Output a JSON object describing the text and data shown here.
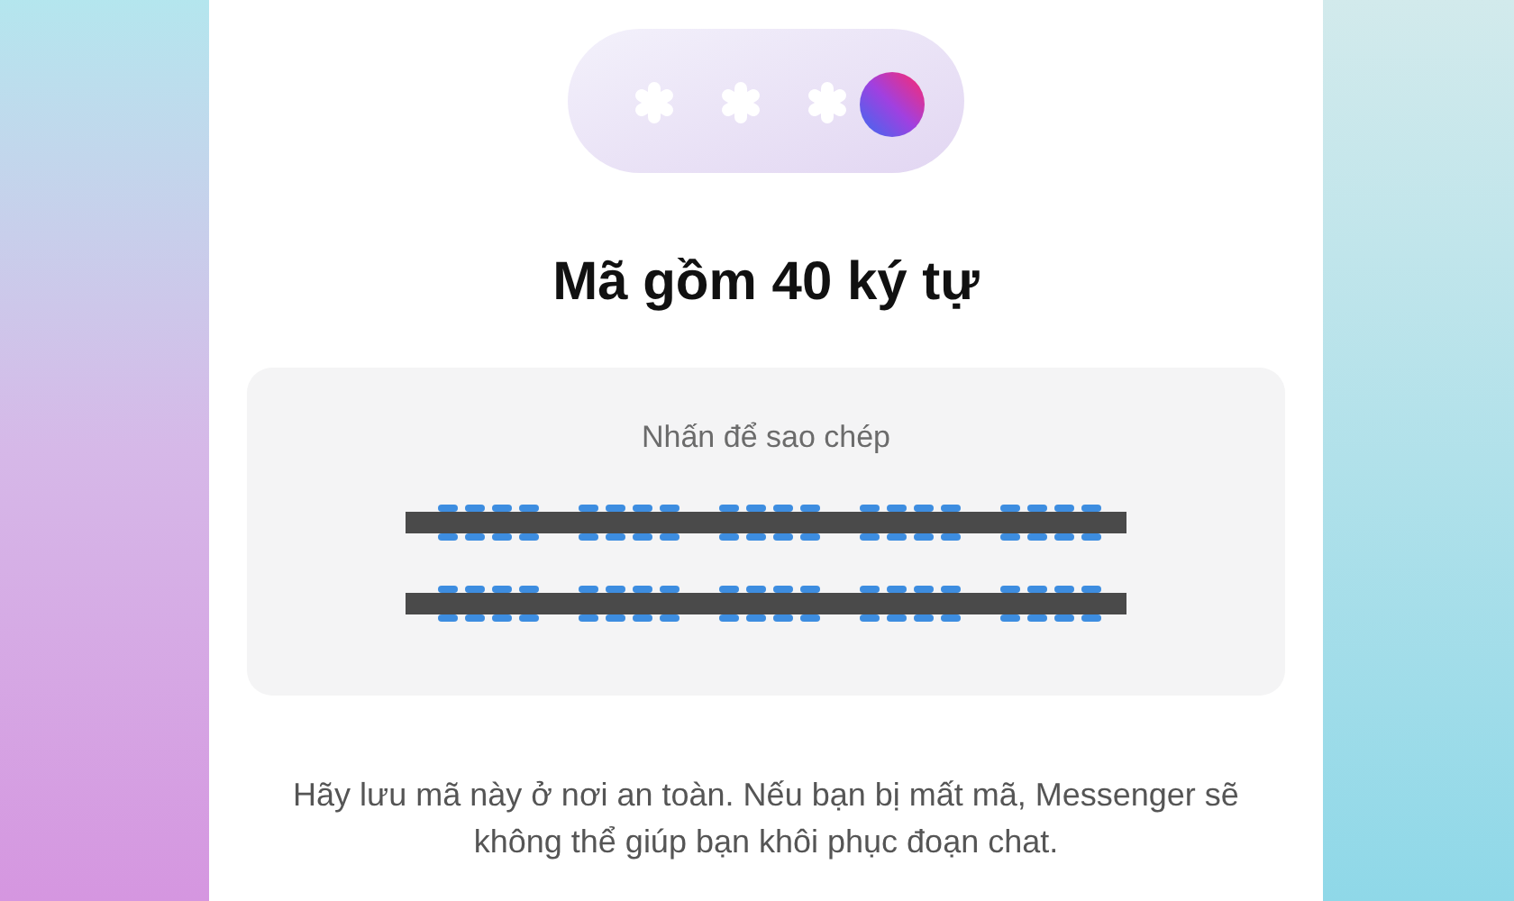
{
  "title": "Mã gồm 40 ký tự",
  "code_card": {
    "hint": "Nhấn để sao chép",
    "code_lines": [
      {
        "kind": "redacted"
      },
      {
        "kind": "redacted"
      }
    ]
  },
  "message": "Hãy lưu mã này ở nơi an toàn. Nếu bạn bị mất mã, Messenger sẽ không thể giúp bạn khôi phục đoạn chat."
}
